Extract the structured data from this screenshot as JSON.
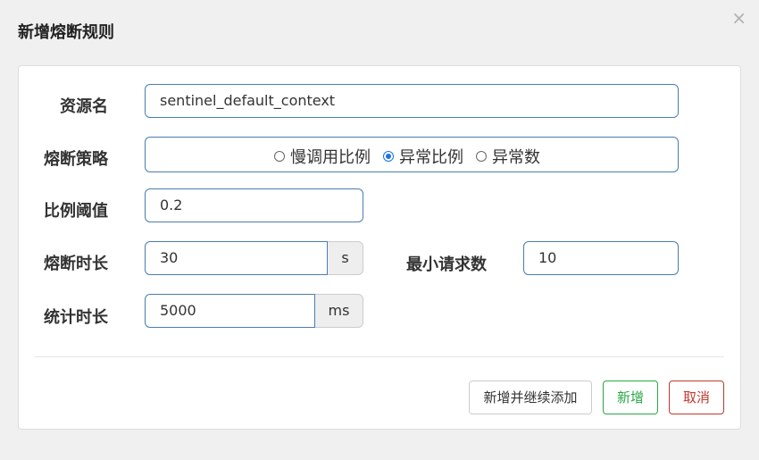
{
  "dialog": {
    "title": "新增熔断规则",
    "close_icon": "close-icon"
  },
  "form": {
    "resource": {
      "label": "资源名",
      "value": "sentinel_default_context"
    },
    "strategy": {
      "label": "熔断策略",
      "options": [
        "慢调用比例",
        "异常比例",
        "异常数"
      ],
      "selected": "异常比例"
    },
    "ratio_threshold": {
      "label": "比例阈值",
      "value": "0.2"
    },
    "break_duration": {
      "label": "熔断时长",
      "value": "30",
      "unit": "s"
    },
    "min_requests": {
      "label": "最小请求数",
      "value": "10"
    },
    "stat_duration": {
      "label": "统计时长",
      "value": "5000",
      "unit": "ms"
    }
  },
  "buttons": {
    "add_continue": "新增并继续添加",
    "add": "新增",
    "cancel": "取消"
  },
  "colors": {
    "input_border": "#4a7db0",
    "add_button": "#28a745",
    "cancel_button": "#c0392b",
    "radio_selected": "#1a73e8"
  }
}
